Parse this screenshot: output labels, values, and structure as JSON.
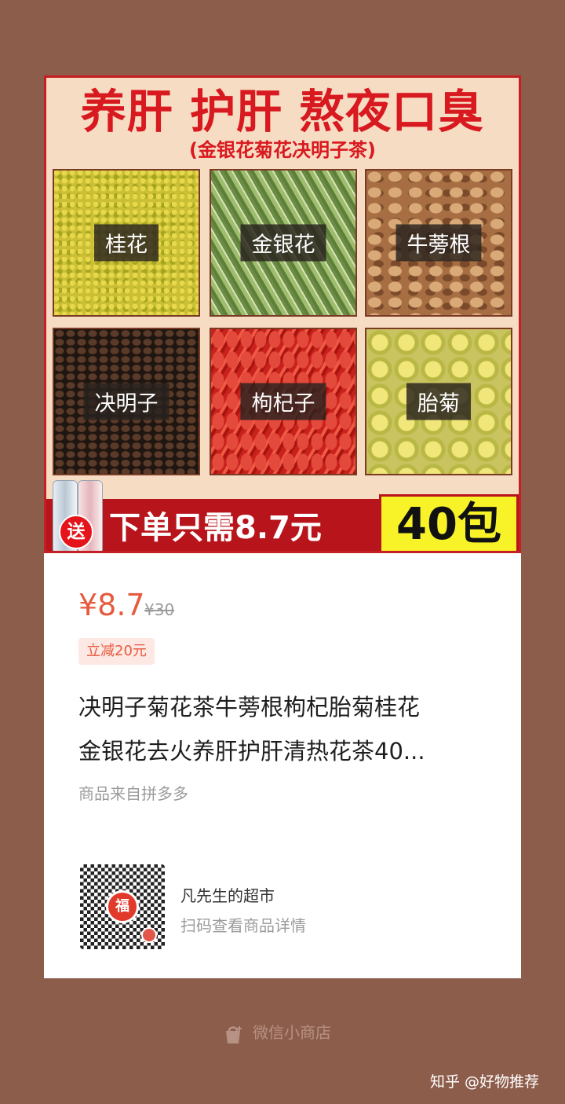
{
  "banner": {
    "title": "养肝  护肝 熬夜口臭",
    "subtitle": "(金银花菊花决明子茶)",
    "tiles": [
      {
        "label": "桂花"
      },
      {
        "label": "金银花"
      },
      {
        "label": "牛蒡根"
      },
      {
        "label": "决明子"
      },
      {
        "label": "枸杞子"
      },
      {
        "label": "胎菊"
      }
    ],
    "gift_label": "送",
    "promo_text": "下单只需8.7元",
    "pack_text": "40包"
  },
  "product": {
    "price": "¥8.7",
    "original_price": "¥30",
    "discount": "立减20元",
    "title_line1": "决明子菊花茶牛蒡根枸杞胎菊桂花",
    "title_line2": "金银花去火养肝护肝清热花茶40...",
    "source": "商品来自拼多多",
    "accent_color": "#e65a3d"
  },
  "shop": {
    "qr_center": "福",
    "name": "凡先生的超市",
    "hint": "扫码查看商品详情"
  },
  "footer": {
    "brand": "微信小商店",
    "watermark": "知乎 @好物推荐"
  }
}
